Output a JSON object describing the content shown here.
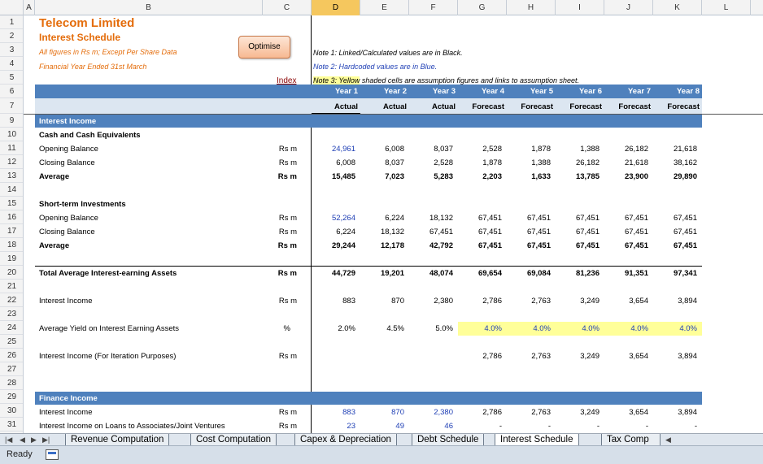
{
  "columns": [
    "A",
    "B",
    "C",
    "D",
    "E",
    "F",
    "G",
    "H",
    "I",
    "J",
    "K",
    "L"
  ],
  "rows": [
    "1",
    "2",
    "3",
    "4",
    "5",
    "6",
    "7",
    "9",
    "10",
    "11",
    "12",
    "13",
    "14",
    "15",
    "16",
    "17",
    "18",
    "19",
    "20",
    "21",
    "22",
    "23",
    "24",
    "25",
    "26",
    "27",
    "28",
    "29",
    "30",
    "31"
  ],
  "header": {
    "title": "Telecom Limited",
    "subtitle": "Interest Schedule",
    "units_note": "All figures in Rs m; Except Per Share Data",
    "fy_note": "Financial Year Ended 31st March",
    "optimise_label": "Optimise",
    "index_link": "Index",
    "note1": "Note 1: Linked/Calculated values are in Black.",
    "note2": "Note 2: Hardcoded values are in Blue.",
    "note3_a": "Note 3: Yellow",
    "note3_b": " shaded cells are assumption figures and links to assumption sheet."
  },
  "years": [
    "Year 1",
    "Year 2",
    "Year 3",
    "Year 4",
    "Year 5",
    "Year 6",
    "Year 7",
    "Year 8"
  ],
  "types": [
    "Actual",
    "Actual",
    "Actual",
    "Forecast",
    "Forecast",
    "Forecast",
    "Forecast",
    "Forecast"
  ],
  "sections": {
    "interest_income": "Interest Income",
    "cash": "Cash and Cash Equivalents",
    "st_inv": "Short-term Investments",
    "finance_income": "Finance Income"
  },
  "lines": {
    "r11": {
      "label": "Opening Balance",
      "unit": "Rs m",
      "values": [
        "24,961",
        "6,008",
        "8,037",
        "2,528",
        "1,878",
        "1,388",
        "26,182",
        "21,618"
      ]
    },
    "r12": {
      "label": "Closing Balance",
      "unit": "Rs m",
      "values": [
        "6,008",
        "8,037",
        "2,528",
        "1,878",
        "1,388",
        "26,182",
        "21,618",
        "38,162"
      ]
    },
    "r13": {
      "label": "Average",
      "unit": "Rs m",
      "values": [
        "15,485",
        "7,023",
        "5,283",
        "2,203",
        "1,633",
        "13,785",
        "23,900",
        "29,890"
      ]
    },
    "r16": {
      "label": "Opening Balance",
      "unit": "Rs m",
      "values": [
        "52,264",
        "6,224",
        "18,132",
        "67,451",
        "67,451",
        "67,451",
        "67,451",
        "67,451"
      ]
    },
    "r17": {
      "label": "Closing Balance",
      "unit": "Rs m",
      "values": [
        "6,224",
        "18,132",
        "67,451",
        "67,451",
        "67,451",
        "67,451",
        "67,451",
        "67,451"
      ]
    },
    "r18": {
      "label": "Average",
      "unit": "Rs m",
      "values": [
        "29,244",
        "12,178",
        "42,792",
        "67,451",
        "67,451",
        "67,451",
        "67,451",
        "67,451"
      ]
    },
    "r20": {
      "label": "Total Average Interest-earning Assets",
      "unit": "Rs m",
      "values": [
        "44,729",
        "19,201",
        "48,074",
        "69,654",
        "69,084",
        "81,236",
        "91,351",
        "97,341"
      ]
    },
    "r22": {
      "label": "Interest Income",
      "unit": "Rs m",
      "values": [
        "883",
        "870",
        "2,380",
        "2,786",
        "2,763",
        "3,249",
        "3,654",
        "3,894"
      ]
    },
    "r24": {
      "label": "Average Yield on Interest Earning Assets",
      "unit": "%",
      "values": [
        "2.0%",
        "4.5%",
        "5.0%",
        "4.0%",
        "4.0%",
        "4.0%",
        "4.0%",
        "4.0%"
      ]
    },
    "r26": {
      "label": "Interest Income (For Iteration Purposes)",
      "unit": "Rs m",
      "values": [
        "",
        "",
        "",
        "2,786",
        "2,763",
        "3,249",
        "3,654",
        "3,894"
      ]
    },
    "r30": {
      "label": "Interest Income",
      "unit": "Rs m",
      "values": [
        "883",
        "870",
        "2,380",
        "2,786",
        "2,763",
        "3,249",
        "3,654",
        "3,894"
      ]
    },
    "r31": {
      "label": "Interest Income on Loans to Associates/Joint Ventures",
      "unit": "Rs m",
      "values": [
        "23",
        "49",
        "46",
        "-",
        "-",
        "-",
        "-",
        "-"
      ]
    }
  },
  "tabs": [
    "Revenue Computation",
    "Cost Computation",
    "Capex & Depreciation",
    "Debt Schedule",
    "Interest Schedule",
    "Tax Comp"
  ],
  "active_tab": "Interest Schedule",
  "status": {
    "ready": "Ready"
  },
  "colors": {
    "band": "#4f81bd",
    "band_light": "#dce6f1",
    "accent_orange": "#e46c0a",
    "hardcoded_blue": "#1f3fb5",
    "assumption_yellow": "#ffff99"
  }
}
